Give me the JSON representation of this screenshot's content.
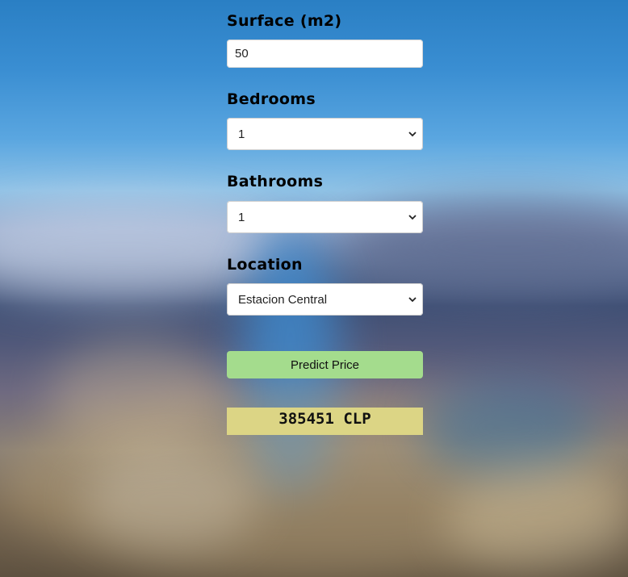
{
  "form": {
    "surface": {
      "label": "Surface (m2)",
      "value": "50"
    },
    "bedrooms": {
      "label": "Bedrooms",
      "selected": "1"
    },
    "bathrooms": {
      "label": "Bathrooms",
      "selected": "1"
    },
    "location": {
      "label": "Location",
      "selected": "Estacion Central"
    },
    "predict_button_label": "Predict Price"
  },
  "result": {
    "text": "385451 CLP"
  },
  "colors": {
    "button_bg": "#a4dc8d",
    "result_bg": "#dcd585",
    "field_bg": "#ffffff"
  },
  "icons": {
    "select_arrow": "chevron-down-icon"
  }
}
